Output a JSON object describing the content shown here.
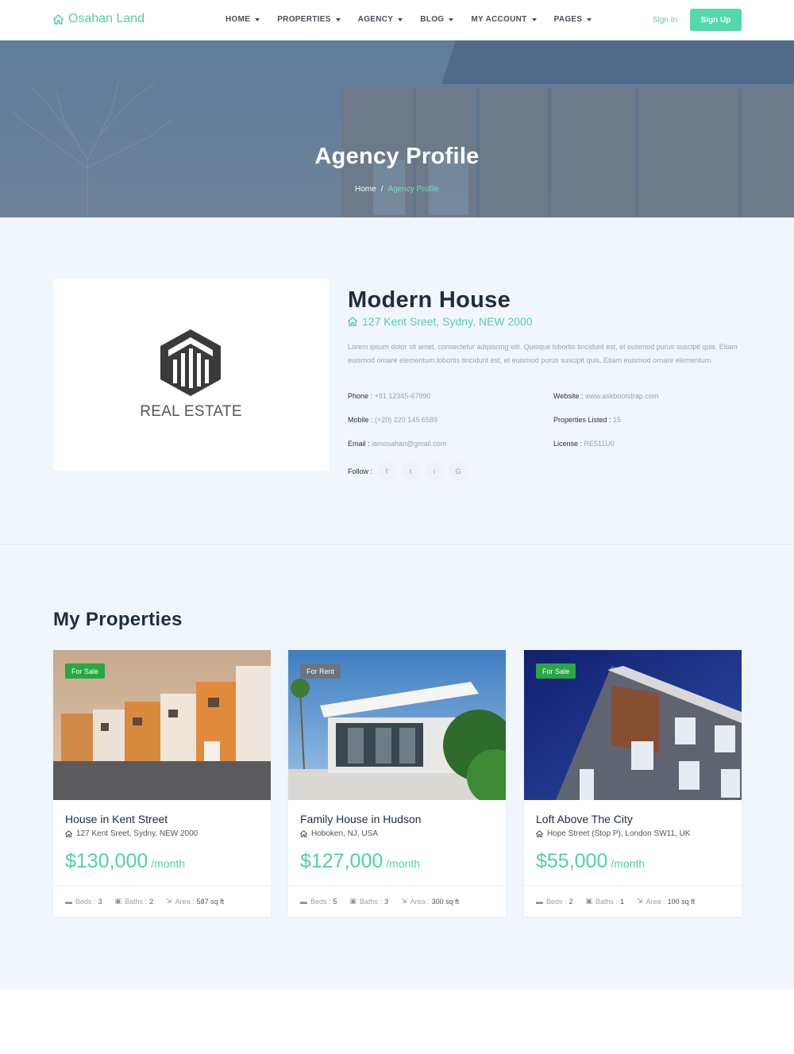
{
  "brand": {
    "name": "Osahan Land"
  },
  "nav": {
    "items": [
      {
        "label": "HOME"
      },
      {
        "label": "PROPERTIES"
      },
      {
        "label": "AGENCY"
      },
      {
        "label": "BLOG"
      },
      {
        "label": "MY ACCOUNT"
      },
      {
        "label": "PAGES"
      }
    ],
    "sign_in": "Sign In",
    "sign_up": "Sign Up"
  },
  "hero": {
    "title": "Agency Profile",
    "breadcrumb": {
      "home": "Home",
      "separator": "/",
      "current": "Agency Profile"
    }
  },
  "profile": {
    "logo_text": "REAL ESTATE",
    "name": "Modern House",
    "address": "127 Kent Sreet, Sydny, NEW 2000",
    "description": "Lorem ipsum dolor sit amet, consectetur adipiscing elit. Quisque lobortis tincidunt est, et euismod purus suscipit quis. Etiam euismod ornare elementum.lobortis tincidunt est, et euismod purus suscipit quis. Etiam euismod ornare elementum.",
    "phone": {
      "label": "Phone :",
      "value": "+91 12345-67890"
    },
    "mobile": {
      "label": "Mobile :",
      "value": "(+20) 220 145 6589"
    },
    "email": {
      "label": "Email :",
      "value": "iamosahan@gmail.com"
    },
    "website": {
      "label": "Website :",
      "value": "www.askbootstrap.com"
    },
    "properties_listed": {
      "label": "Properties Listed :",
      "value": "15"
    },
    "license": {
      "label": "License :",
      "value": "RE511U0"
    },
    "follow_label": "Follow :",
    "social": [
      "f",
      "t",
      "i",
      "G"
    ]
  },
  "properties": {
    "title": "My Properties",
    "cards": [
      {
        "badge": "For Sale",
        "name": "House in Kent Street",
        "address": "127 Kent Sreet, Sydny, NEW 2000",
        "price": "$130,000",
        "period": "/month",
        "beds_label": "Beds :",
        "beds": "3",
        "baths_label": "Baths :",
        "baths": "2",
        "area_label": "Area :",
        "area": "587 sq ft"
      },
      {
        "badge": "For Rent",
        "name": "Family House in Hudson",
        "address": "Hoboken, NJ, USA",
        "price": "$127,000",
        "period": "/month",
        "beds_label": "Beds :",
        "beds": "5",
        "baths_label": "Baths :",
        "baths": "3",
        "area_label": "Area :",
        "area": "300 sq ft"
      },
      {
        "badge": "For Sale",
        "name": "Loft Above The City",
        "address": "Hope Street (Stop P), London SW11, UK",
        "price": "$55,000",
        "period": "/month",
        "beds_label": "Beds :",
        "beds": "2",
        "baths_label": "Baths :",
        "baths": "1",
        "area_label": "Area :",
        "area": "100 sq ft"
      }
    ]
  },
  "colors": {
    "accent": "#53cfa6",
    "sale_badge": "#28a745",
    "rent_badge": "#6c757d",
    "section_bg": "#f1f6fd"
  }
}
